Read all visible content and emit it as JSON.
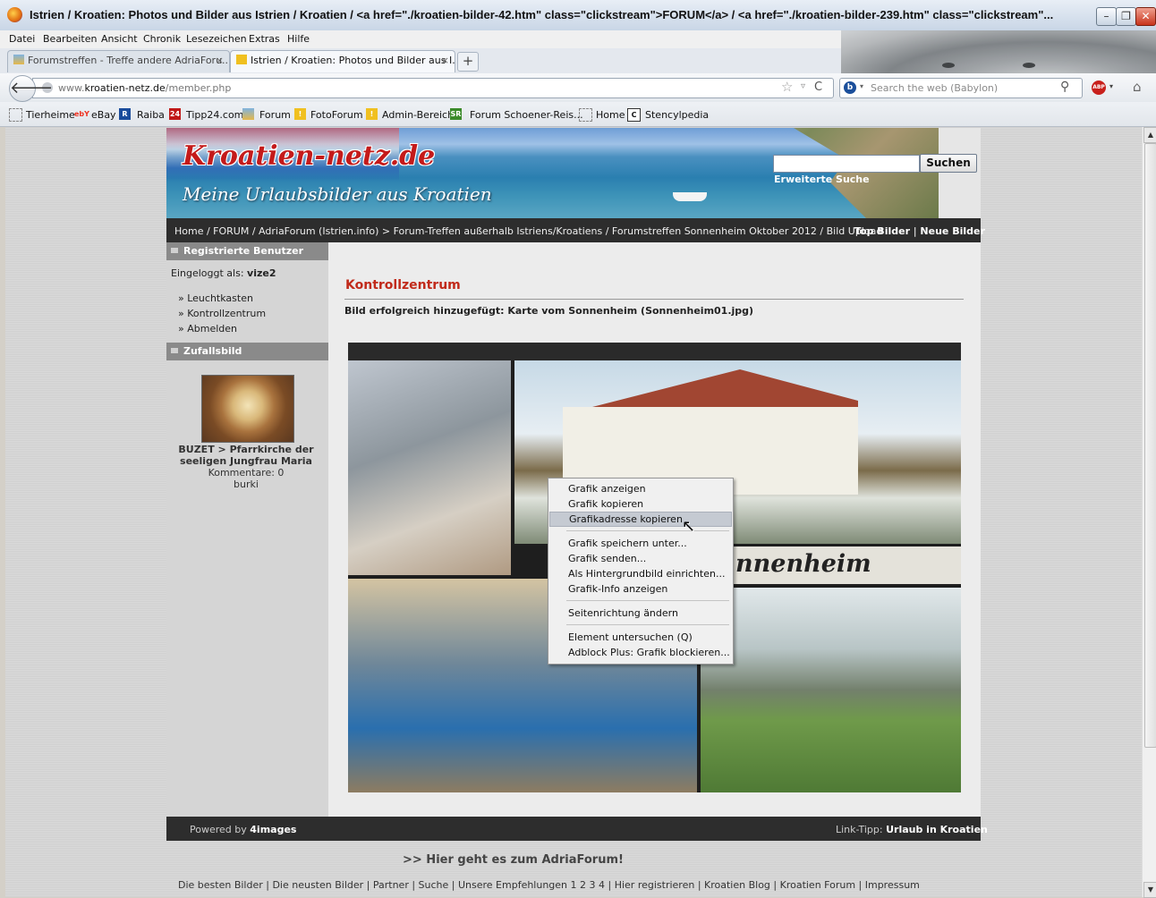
{
  "window": {
    "title": "Istrien / Kroatien: Photos und Bilder aus Istrien / Kroatien / <a href=\"./kroatien-bilder-42.htm\" class=\"clickstream\">FORUM</a> / <a href=\"./kroatien-bilder-239.htm\" class=\"clickstream\"...",
    "minimize": "–",
    "restore": "❐",
    "close": "✕"
  },
  "menu": [
    "Datei",
    "Bearbeiten",
    "Ansicht",
    "Chronik",
    "Lesezeichen",
    "Extras",
    "Hilfe"
  ],
  "tabs": [
    {
      "label": "Forumstreffen - Treffe andere AdriaForu...",
      "close": "×"
    },
    {
      "label": "Istrien / Kroatien: Photos und Bilder aus I...",
      "close": "×"
    }
  ],
  "newtab": "+",
  "nav": {
    "back": "🡐",
    "url_prefix": "www.",
    "url_domain": "kroatien-netz.de",
    "url_path": "/member.php",
    "star": "☆",
    "dropdown": "▿",
    "reload": "C",
    "search_placeholder": "Search the web (Babylon)",
    "search_engine_icon": "b",
    "magnifier": "⚲",
    "abp": "ABP",
    "home": "⌂"
  },
  "bookmarks": [
    "Tierheime",
    "eBay",
    "Raiba",
    "Tipp24.com",
    "Forum",
    "FotoForum",
    "Admin-Bereich",
    "Forum Schoener-Reis...",
    "Home",
    "Stencylpedia"
  ],
  "bookmark_icons": {
    "ebay": "ebY",
    "raiba": "R",
    "tipp24": "24",
    "foto": "!",
    "admin": "!",
    "sr": "SR",
    "stencyl": "C"
  },
  "header": {
    "logo_title": "Kroatien-netz.de",
    "logo_subtitle": "Meine Urlaubsbilder aus Kroatien",
    "search_button": "Suchen",
    "advanced_search": "Erweiterte Suche"
  },
  "breadcrumb": "Home / FORUM / AdriaForum (Istrien.info) > Forum-Treffen außerhalb Istriens/Kroatiens / Forumstreffen Sonnenheim Oktober 2012 / Bild Upload",
  "toplinks": {
    "top": "Top Bilder",
    "sep": "|",
    "new": "Neue Bilder"
  },
  "sidebar": {
    "section1": "Registrierte Benutzer",
    "logged_label": "Eingeloggt als:",
    "logged_user": "vize2",
    "links": [
      "» Leuchtkasten",
      "» Kontrollzentrum",
      "» Abmelden"
    ],
    "section2": "Zufallsbild",
    "random_title": "BUZET > Pfarrkirche der seeligen Jungfrau Maria",
    "random_comments": "Kommentare: 0",
    "random_user": "burki"
  },
  "main": {
    "title": "Kontrollzentrum",
    "message": "Bild erfolgreich hinzugefügt: Karte vom Sonnenheim (Sonnenheim01.jpg)",
    "photo_text": "nnenheim"
  },
  "context_menu": {
    "items": [
      "Grafik anzeigen",
      "Grafik kopieren",
      "Grafikadresse kopieren",
      "Grafik speichern unter...",
      "Grafik senden...",
      "Als Hintergrundbild einrichten...",
      "Grafik-Info anzeigen",
      "Seitenrichtung ändern",
      "Element untersuchen (Q)",
      "Adblock Plus: Grafik blockieren..."
    ],
    "highlighted_index": 2
  },
  "footer": {
    "powered_prefix": "Powered by",
    "powered_brand": "4images",
    "linktipp_prefix": "Link-Tipp:",
    "linktipp_link": "Urlaub in Kroatien",
    "adria": ">> Hier geht es zum AdriaForum!",
    "links": "Die besten Bilder | Die neusten Bilder | Partner | Suche | Unsere Empfehlungen 1 2 3 4 | Hier registrieren | Kroatien Blog | Kroatien Forum | Impressum"
  },
  "scrollbar": {
    "up": "▲",
    "down": "▼"
  },
  "cursor": "↖",
  "colors": {
    "accent_red": "#c12a1a",
    "dark_bar": "#2d2d2d",
    "side_head": "#8a8a8a"
  }
}
